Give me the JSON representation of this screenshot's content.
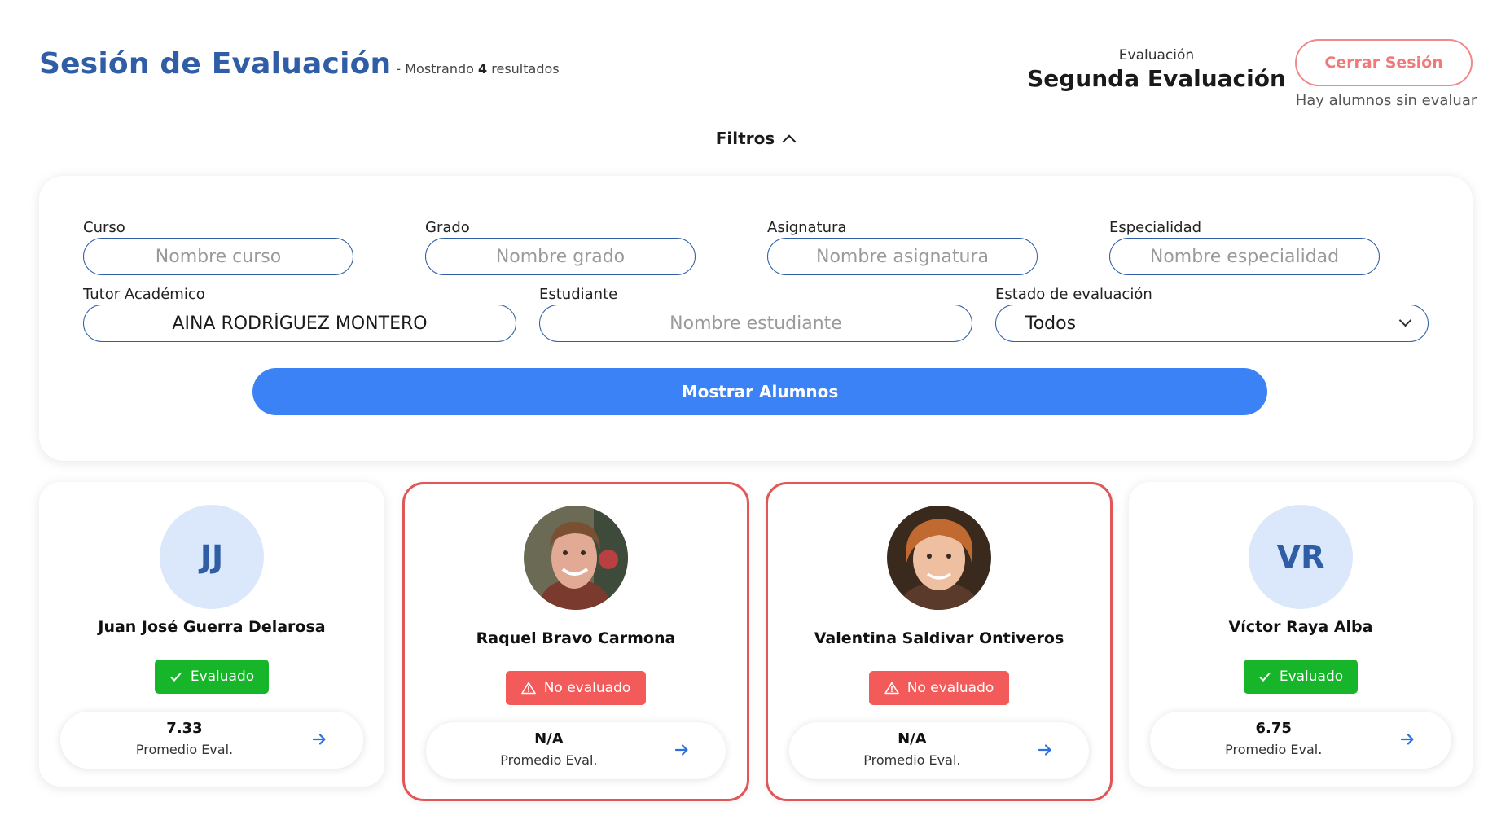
{
  "header": {
    "title": "Sesión de Evaluación",
    "results_prefix": "- Mostrando",
    "results_count": "4",
    "results_suffix": "resultados"
  },
  "evaluation": {
    "caption": "Evaluación",
    "name": "Segunda Evaluación"
  },
  "session": {
    "logout_label": "Cerrar Sesión",
    "warning": "Hay alumnos sin evaluar"
  },
  "filters": {
    "toggle_label": "Filtros",
    "curso": {
      "label": "Curso",
      "placeholder": "Nombre curso",
      "value": ""
    },
    "grado": {
      "label": "Grado",
      "placeholder": "Nombre grado",
      "value": ""
    },
    "asignatura": {
      "label": "Asignatura",
      "placeholder": "Nombre asignatura",
      "value": ""
    },
    "especialidad": {
      "label": "Especialidad",
      "placeholder": "Nombre especialidad",
      "value": ""
    },
    "tutor": {
      "label": "Tutor Académico",
      "placeholder": "",
      "value": "AINA RODRÍGUEZ MONTERO"
    },
    "estudiante": {
      "label": "Estudiante",
      "placeholder": "Nombre estudiante",
      "value": ""
    },
    "estado": {
      "label": "Estado de evaluación",
      "selected": "Todos"
    },
    "submit_label": "Mostrar Alumnos"
  },
  "students": [
    {
      "name": "Juan José Guerra Delarosa",
      "initials": "JJ",
      "status": "Evaluado",
      "average": "7.33",
      "average_label": "Promedio Eval."
    },
    {
      "name": "Raquel Bravo Carmona",
      "initials": "",
      "status": "No evaluado",
      "average": "N/A",
      "average_label": "Promedio Eval."
    },
    {
      "name": "Valentina Saldivar Ontiveros",
      "initials": "",
      "status": "No evaluado",
      "average": "N/A",
      "average_label": "Promedio Eval."
    },
    {
      "name": "Víctor Raya Alba",
      "initials": "VR",
      "status": "Evaluado",
      "average": "6.75",
      "average_label": "Promedio Eval."
    }
  ],
  "colors": {
    "brand_blue": "#2f5ea6",
    "primary_button": "#3b82f6",
    "success": "#17b52a",
    "danger": "#f35a5a",
    "flag_border": "#e05757"
  },
  "icons": {
    "filters_toggle": "chevron-up-icon",
    "estado_select": "chevron-down-icon",
    "evaluated_badge": "check-icon",
    "not_evaluated_badge": "warning-icon",
    "card_link": "arrow-right-icon"
  }
}
